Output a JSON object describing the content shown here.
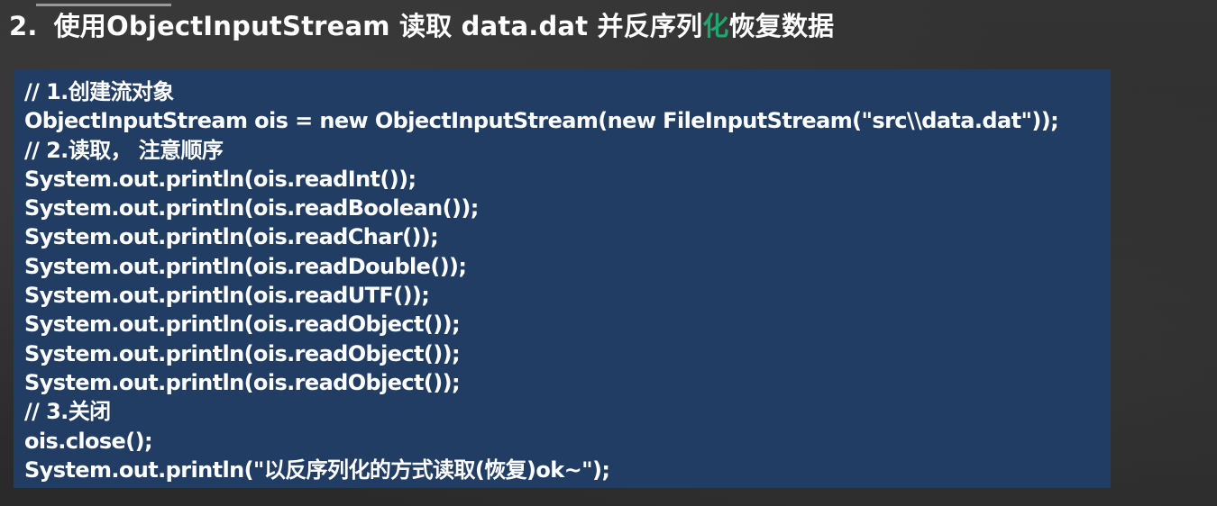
{
  "title": {
    "number": "2.",
    "before": "使用ObjectInputStream 读取 data.dat 并反序列",
    "highlight": "化",
    "after": "恢复数据"
  },
  "code": {
    "lines": [
      "// 1.创建流对象",
      "ObjectInputStream ois = new ObjectInputStream(new FileInputStream(\"src\\\\data.dat\"));",
      "// 2.读取， 注意顺序",
      "System.out.println(ois.readInt());",
      "System.out.println(ois.readBoolean());",
      "System.out.println(ois.readChar());",
      "System.out.println(ois.readDouble());",
      "System.out.println(ois.readUTF());",
      "System.out.println(ois.readObject());",
      "System.out.println(ois.readObject());",
      "System.out.println(ois.readObject());",
      "// 3.关闭",
      "ois.close();",
      "System.out.println(\"以反序列化的方式读取(恢复)ok~\");"
    ]
  },
  "colors": {
    "background": "#2e2e2e",
    "code_box": "#213d63",
    "text": "#ffffff",
    "highlight": "#1fa86b"
  }
}
